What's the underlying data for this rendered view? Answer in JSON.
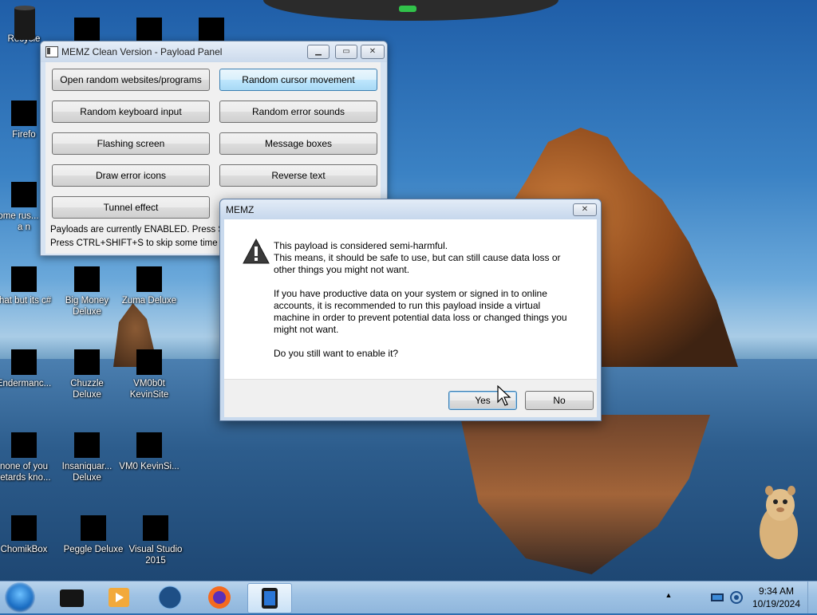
{
  "desktop": {
    "icons": [
      {
        "label": "Recycle"
      },
      {
        "label": "Firefo"
      },
      {
        "label": "some rus... ran a n"
      },
      {
        "label": "that but its c#"
      },
      {
        "label": "Big Money Deluxe"
      },
      {
        "label": "Zuma Deluxe"
      },
      {
        "label": "Endermanc..."
      },
      {
        "label": "Chuzzle Deluxe"
      },
      {
        "label": "VM0b0t KevinSite"
      },
      {
        "label": "none of you retards kno..."
      },
      {
        "label": "Insaniquar... Deluxe"
      },
      {
        "label": "VM0 KevinSi..."
      },
      {
        "label": "ChomikBox"
      },
      {
        "label": "Peggle Deluxe"
      },
      {
        "label": "Visual Studio 2015"
      }
    ]
  },
  "payload_panel": {
    "title": "MEMZ Clean Version - Payload Panel",
    "buttons": [
      {
        "label": "Open random websites/programs"
      },
      {
        "label": "Random cursor movement"
      },
      {
        "label": "Random keyboard input"
      },
      {
        "label": "Random error sounds"
      },
      {
        "label": "Flashing screen"
      },
      {
        "label": "Message boxes"
      },
      {
        "label": "Draw error icons"
      },
      {
        "label": "Reverse text"
      },
      {
        "label": "Tunnel effect"
      }
    ],
    "status_line_1": "Payloads are currently ENABLED. Press SHI",
    "status_line_2": "Press CTRL+SHIFT+S to skip some time (mak"
  },
  "dialog": {
    "title": "MEMZ",
    "para1_line1": "This payload is considered semi-harmful.",
    "para1_line2": "This means, it should be safe to use, but can still cause data loss or",
    "para1_line3": "other things you might not want.",
    "para2_line1": "If you have productive data on your system or signed in to online",
    "para2_line2": "accounts, it is recommended to run this payload inside a virtual",
    "para2_line3": "machine in order to prevent potential data loss or changed things you",
    "para2_line4": "might not want.",
    "question": "Do you still want to enable it?",
    "yes_label": "Yes",
    "no_label": "No",
    "close_glyph": "✕"
  },
  "taskbar": {
    "time": "9:34 AM",
    "date": "10/19/2024",
    "tray_arrow": "▲"
  },
  "colors": {
    "accent": "#3c7fb1",
    "taskbar": "#9ec2e4"
  }
}
